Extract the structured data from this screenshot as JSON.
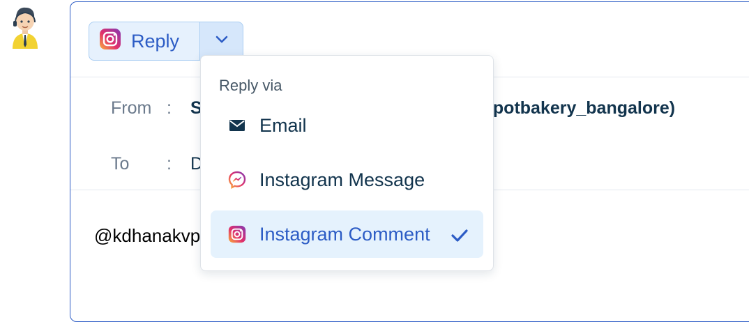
{
  "reply_button": {
    "label": "Reply"
  },
  "header": {
    "from_label": "From",
    "from_value": "S",
    "from_value_tail": "spotbakery_bangalore)",
    "to_label": "To",
    "to_value": "D",
    "colon": ":"
  },
  "body": {
    "text": "@kdhanakvp"
  },
  "dropdown": {
    "heading": "Reply via",
    "items": [
      {
        "label": "Email",
        "icon": "envelope-icon"
      },
      {
        "label": "Instagram Message",
        "icon": "messenger-icon"
      },
      {
        "label": "Instagram Comment",
        "icon": "instagram-icon",
        "selected": true
      }
    ]
  },
  "colors": {
    "accent": "#2c5cc5",
    "selected_bg": "#e5f2fd",
    "text_dark": "#12344d"
  }
}
